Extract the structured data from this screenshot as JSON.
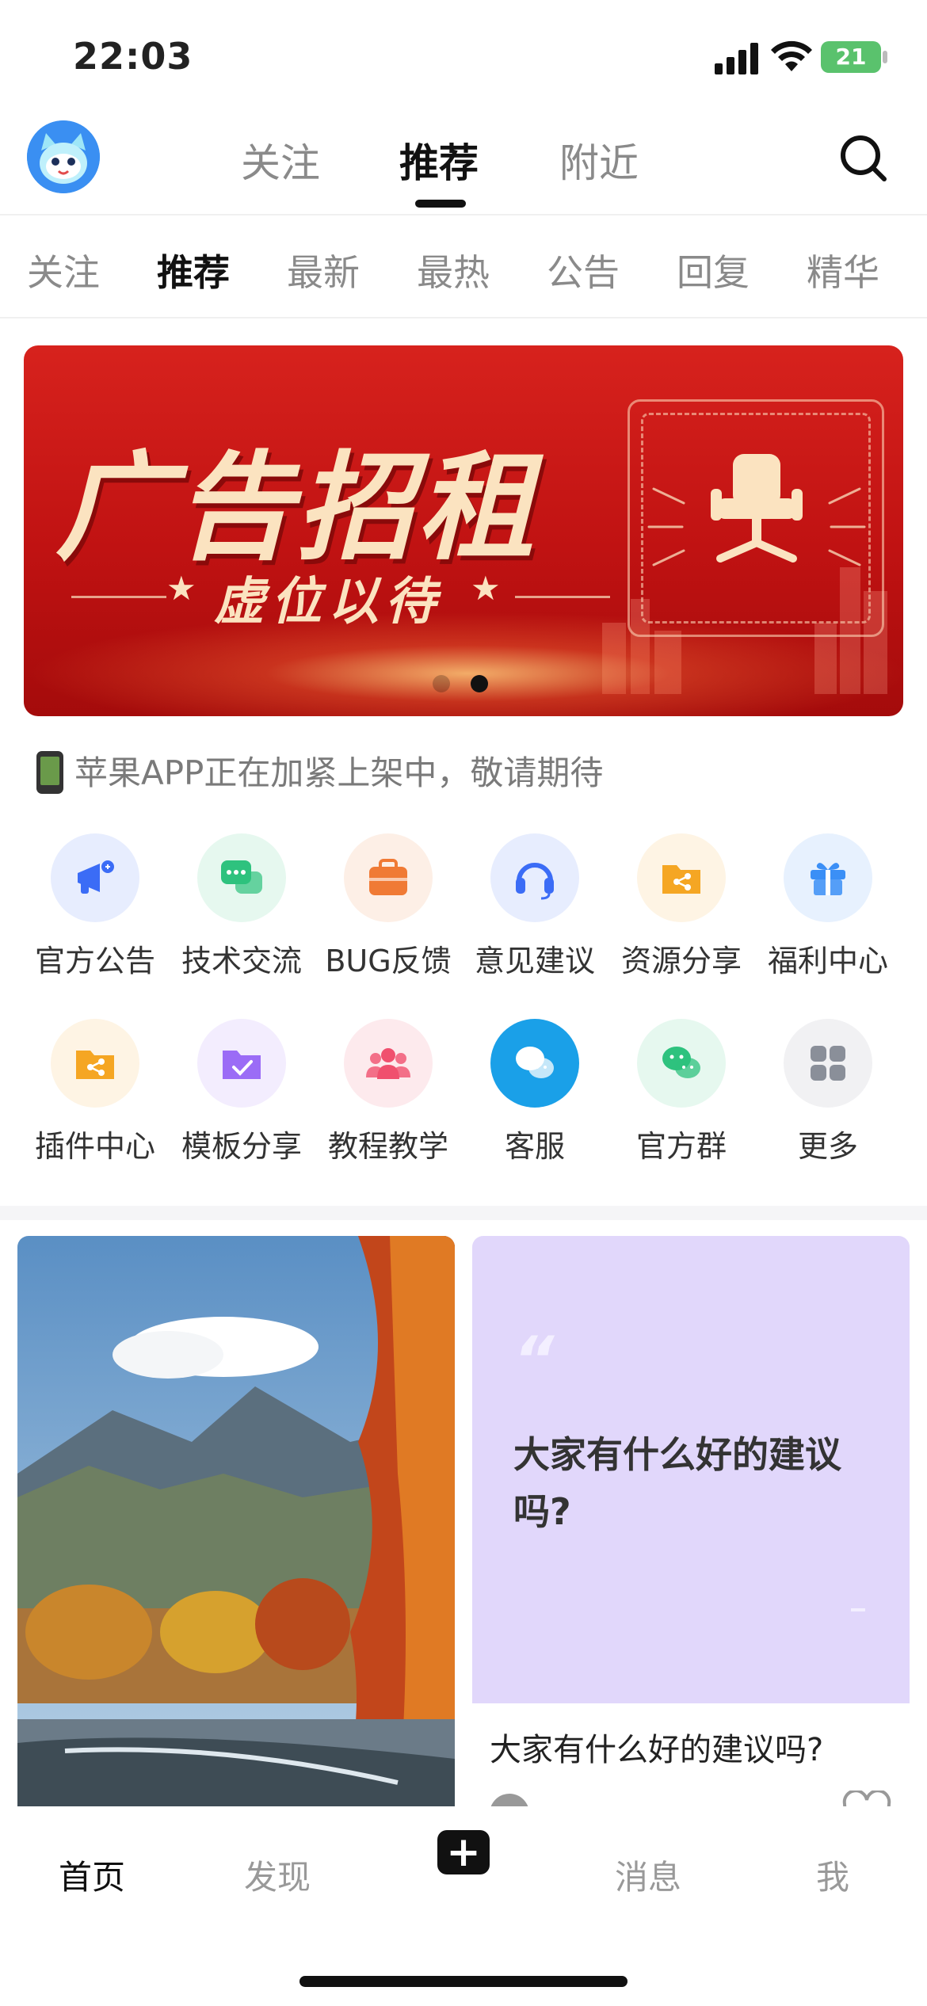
{
  "status": {
    "time": "22:03",
    "battery": "21"
  },
  "top_nav": {
    "tabs": [
      {
        "label": "关注"
      },
      {
        "label": "推荐"
      },
      {
        "label": "附近"
      }
    ],
    "active_tab": "推荐"
  },
  "sub_tabs": [
    "关注",
    "推荐",
    "最新",
    "最热",
    "公告",
    "回复",
    "精华"
  ],
  "banner": {
    "title": "广告招租",
    "subtitle": "虚位以待",
    "slide_count": 2,
    "active_slide": 2
  },
  "notice": "苹果APP正在加紧上架中，敬请期待",
  "shortcuts": [
    {
      "label": "官方公告",
      "icon": "megaphone-icon",
      "color": "#3b6cf6"
    },
    {
      "label": "技术交流",
      "icon": "chat-icon",
      "color": "#2ec27e"
    },
    {
      "label": "BUG反馈",
      "icon": "briefcase-icon",
      "color": "#f07a35"
    },
    {
      "label": "意见建议",
      "icon": "headset-icon",
      "color": "#3b6cf6"
    },
    {
      "label": "资源分享",
      "icon": "share-folder-icon",
      "color": "#f5a623"
    },
    {
      "label": "福利中心",
      "icon": "gift-icon",
      "color": "#3b8ff6"
    },
    {
      "label": "插件中心",
      "icon": "share-folder-icon",
      "color": "#f5a623"
    },
    {
      "label": "模板分享",
      "icon": "check-folder-icon",
      "color": "#9b6cf6"
    },
    {
      "label": "教程教学",
      "icon": "group-icon",
      "color": "#f0506e"
    },
    {
      "label": "客服",
      "icon": "wechat-icon",
      "color": "#1aa0e8"
    },
    {
      "label": "官方群",
      "icon": "wechat-icon",
      "color": "#2ec27e"
    },
    {
      "label": "更多",
      "icon": "more-icon",
      "color": "#8a8f99"
    }
  ],
  "feed": {
    "right_card": {
      "quote": "大家有什么好的建议吗?",
      "title": "大家有什么好的建议吗?"
    }
  },
  "bottom_nav": {
    "tabs": [
      "首页",
      "发现",
      "消息",
      "我"
    ],
    "add_label": "+"
  }
}
